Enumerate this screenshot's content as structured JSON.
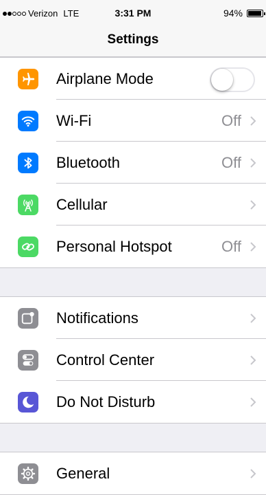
{
  "status_bar": {
    "carrier": "Verizon",
    "network": "LTE",
    "time": "3:31 PM",
    "battery_text": "94%",
    "battery_level": 0.94,
    "signal_bars_filled": 2,
    "signal_bars_total": 5
  },
  "nav": {
    "title": "Settings"
  },
  "groups": [
    {
      "rows": [
        {
          "label": "Airplane Mode",
          "icon": "airplane-icon",
          "color": "#ff9500",
          "accessory": "toggle",
          "toggle_on": false
        },
        {
          "label": "Wi-Fi",
          "icon": "wifi-icon",
          "color": "#007aff",
          "value": "Off"
        },
        {
          "label": "Bluetooth",
          "icon": "bluetooth-icon",
          "color": "#007aff",
          "value": "Off"
        },
        {
          "label": "Cellular",
          "icon": "cellular-antenna-icon",
          "color": "#4cd964",
          "value": ""
        },
        {
          "label": "Personal Hotspot",
          "icon": "hotspot-link-icon",
          "color": "#4cd964",
          "value": "Off"
        }
      ]
    },
    {
      "rows": [
        {
          "label": "Notifications",
          "icon": "notifications-icon",
          "color": "#8e8e93"
        },
        {
          "label": "Control Center",
          "icon": "control-center-icon",
          "color": "#8e8e93"
        },
        {
          "label": "Do Not Disturb",
          "icon": "moon-icon",
          "color": "#5856d6"
        }
      ]
    },
    {
      "rows": [
        {
          "label": "General",
          "icon": "gear-icon",
          "color": "#8e8e93"
        }
      ]
    }
  ]
}
